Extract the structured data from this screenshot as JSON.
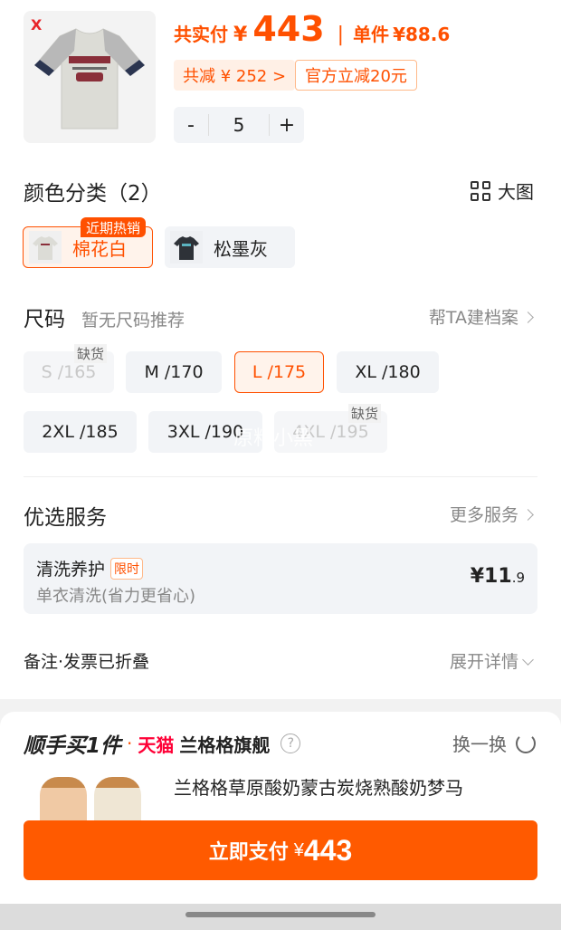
{
  "product": {
    "total_label": "共实付",
    "currency": "¥",
    "total": "443",
    "unit_label": "单件",
    "unit_price": "¥88.6",
    "save_tag": "共减 ¥ 252 >",
    "official_tag": "官方立减20元",
    "minus": "-",
    "quantity": "5",
    "plus": "+",
    "brand_logo": "X"
  },
  "color_section": {
    "title": "颜色分类（2）",
    "big_image": "大图",
    "options": [
      {
        "name": "棉花白",
        "badge": "近期热销",
        "selected": true
      },
      {
        "name": "松墨灰",
        "selected": false
      }
    ]
  },
  "size_section": {
    "title": "尺码",
    "subtitle": "暂无尺码推荐",
    "archive_link": "帮TA建档案",
    "sizes": [
      {
        "label": "S /165",
        "state": "disabled",
        "badge": "缺货"
      },
      {
        "label": "M /170",
        "state": "normal"
      },
      {
        "label": "L /175",
        "state": "selected"
      },
      {
        "label": "XL /180",
        "state": "normal"
      },
      {
        "label": "2XL /185",
        "state": "normal"
      },
      {
        "label": "3XL /190",
        "state": "normal"
      },
      {
        "label": "4XL /195",
        "state": "disabled",
        "badge": "缺货"
      }
    ],
    "watermark": "原料小黑"
  },
  "service_section": {
    "title": "优选服务",
    "more": "更多服务",
    "card": {
      "name": "清洗养护",
      "tag": "限时",
      "desc": "单衣清洗(省力更省心)",
      "price_main": "¥11",
      "price_dec": ".9"
    }
  },
  "notes": {
    "label": "备注·发票已折叠",
    "expand": "展开详情"
  },
  "recommend": {
    "title_a": "顺手买1件",
    "dot": "·",
    "platform": "天猫",
    "shop": "兰格格旗舰",
    "help": "?",
    "swap": "换一换",
    "item_title": "兰格格草原酸奶蒙古炭烧熟酸奶梦马"
  },
  "pay": {
    "label": "立即支付",
    "currency": "¥",
    "amount": "443"
  },
  "colors": {
    "accent": "#ff5000",
    "pay_button": "#ff5a00",
    "tmall": "#ff0036"
  }
}
